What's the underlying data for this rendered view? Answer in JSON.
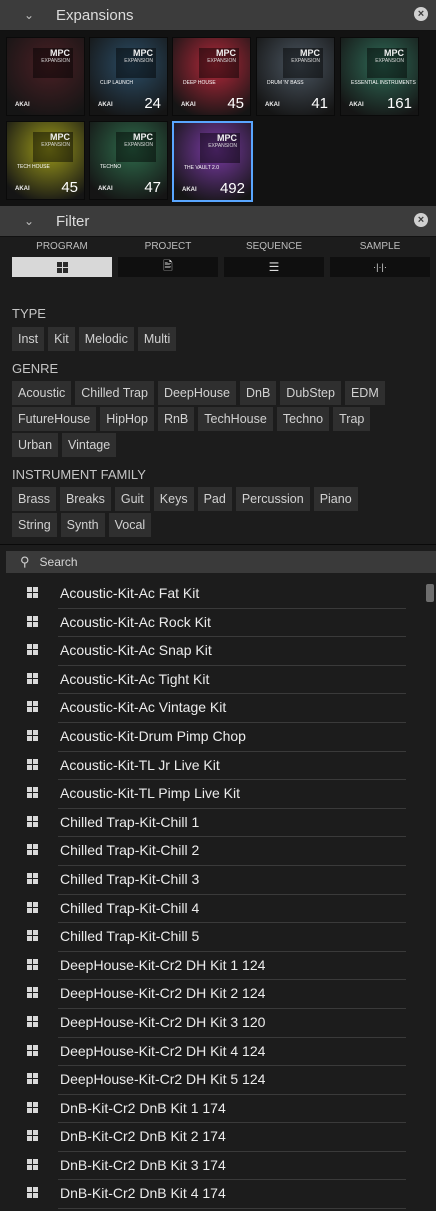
{
  "expansions": {
    "title": "Expansions",
    "tiles": [
      {
        "label": "",
        "count": "",
        "color": "#4a1f24"
      },
      {
        "label": "CLIP LAUNCH",
        "count": "24",
        "color": "#2b4d66"
      },
      {
        "label": "DEEP HOUSE",
        "count": "45",
        "color": "#b3283a"
      },
      {
        "label": "DRUM 'N' BASS",
        "count": "41",
        "color": "#4a5560"
      },
      {
        "label": "ESSENTIAL INSTRUMENTS",
        "count": "161",
        "color": "#2f6b57"
      },
      {
        "label": "TECH HOUSE",
        "count": "45",
        "color": "#9c9a1a"
      },
      {
        "label": "TECHNO",
        "count": "47",
        "color": "#2e6b4b"
      },
      {
        "label": "THE VAULT 2.0",
        "count": "492",
        "color": "#7a3aa5"
      }
    ],
    "mpc": "MPC",
    "mpc_sub": "EXPANSION",
    "akai": "AKAI"
  },
  "filter": {
    "title": "Filter",
    "tabs": [
      {
        "label": "PROGRAM",
        "icon": "grid-icon",
        "glyph": ""
      },
      {
        "label": "PROJECT",
        "icon": "document-icon",
        "glyph": "🖹"
      },
      {
        "label": "SEQUENCE",
        "icon": "sequence-icon",
        "glyph": "☰"
      },
      {
        "label": "SAMPLE",
        "icon": "waveform-icon",
        "glyph": "·|·|·"
      }
    ],
    "type_title": "TYPE",
    "type_chips": [
      "Inst",
      "Kit",
      "Melodic",
      "Multi"
    ],
    "genre_title": "GENRE",
    "genre_row1": [
      "Acoustic",
      "Chilled Trap",
      "DeepHouse",
      "DnB",
      "DubStep",
      "EDM"
    ],
    "genre_row2": [
      "FutureHouse",
      "HipHop",
      "RnB",
      "TechHouse",
      "Techno",
      "Trap"
    ],
    "genre_row3": [
      "Urban",
      "Vintage"
    ],
    "family_title": "INSTRUMENT FAMILY",
    "family_row1": [
      "Brass",
      "Breaks",
      "Guit",
      "Keys",
      "Pad",
      "Percussion",
      "Piano"
    ],
    "family_row2": [
      "String",
      "Synth",
      "Vocal"
    ]
  },
  "search": {
    "placeholder": "Search"
  },
  "list": [
    "Acoustic-Kit-Ac Fat Kit",
    "Acoustic-Kit-Ac Rock Kit",
    "Acoustic-Kit-Ac Snap Kit",
    "Acoustic-Kit-Ac Tight Kit",
    "Acoustic-Kit-Ac Vintage Kit",
    "Acoustic-Kit-Drum Pimp Chop",
    "Acoustic-Kit-TL Jr Live Kit",
    "Acoustic-Kit-TL Pimp Live Kit",
    "Chilled Trap-Kit-Chill 1",
    "Chilled Trap-Kit-Chill 2",
    "Chilled Trap-Kit-Chill 3",
    "Chilled Trap-Kit-Chill 4",
    "Chilled Trap-Kit-Chill 5",
    "DeepHouse-Kit-Cr2 DH Kit 1 124",
    "DeepHouse-Kit-Cr2 DH Kit 2 124",
    "DeepHouse-Kit-Cr2 DH Kit 3 120",
    "DeepHouse-Kit-Cr2 DH Kit 4 124",
    "DeepHouse-Kit-Cr2 DH Kit 5 124",
    "DnB-Kit-Cr2 DnB Kit 1 174",
    "DnB-Kit-Cr2 DnB Kit 2 174",
    "DnB-Kit-Cr2 DnB Kit 3 174",
    "DnB-Kit-Cr2 DnB Kit 4 174"
  ]
}
